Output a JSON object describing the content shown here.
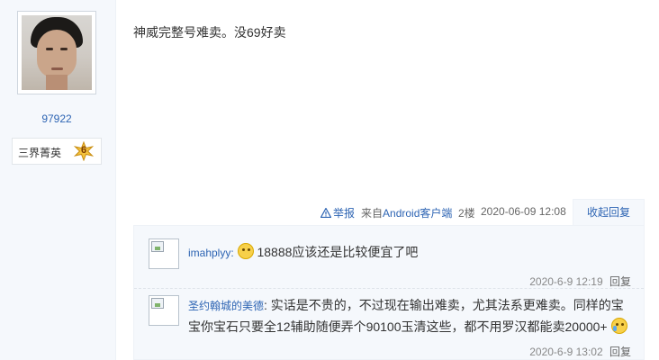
{
  "author": {
    "uid": "97922",
    "rank_title": "三界菁英",
    "rank_level": "6",
    "avatar_icon": "user-avatar-photo"
  },
  "post": {
    "content": "神威完整号难卖。没69好卖",
    "report_label": "举报",
    "source_prefix": "来自",
    "source_client": "Android客户端",
    "floor": "2楼",
    "time": "2020-06-09 12:08",
    "collapse_label": "收起回复"
  },
  "replies": [
    {
      "user": "imahplyy",
      "text": "18888应该还是比较便宜了吧",
      "time": "2020-6-9 12:19",
      "reply_label": "回复"
    },
    {
      "user": "圣约翰城的美德",
      "text": "实话是不贵的，不过现在输出难卖，尤其法系更难卖。同样的宝宝你宝石只要全12辅助随便弄个90100玉清这些，都不用罗汉都能卖20000+",
      "time": "2020-6-9 13:02",
      "reply_label": "回复"
    }
  ],
  "colors": {
    "link": "#2d64b3",
    "side_bg": "#f5f8fc"
  }
}
